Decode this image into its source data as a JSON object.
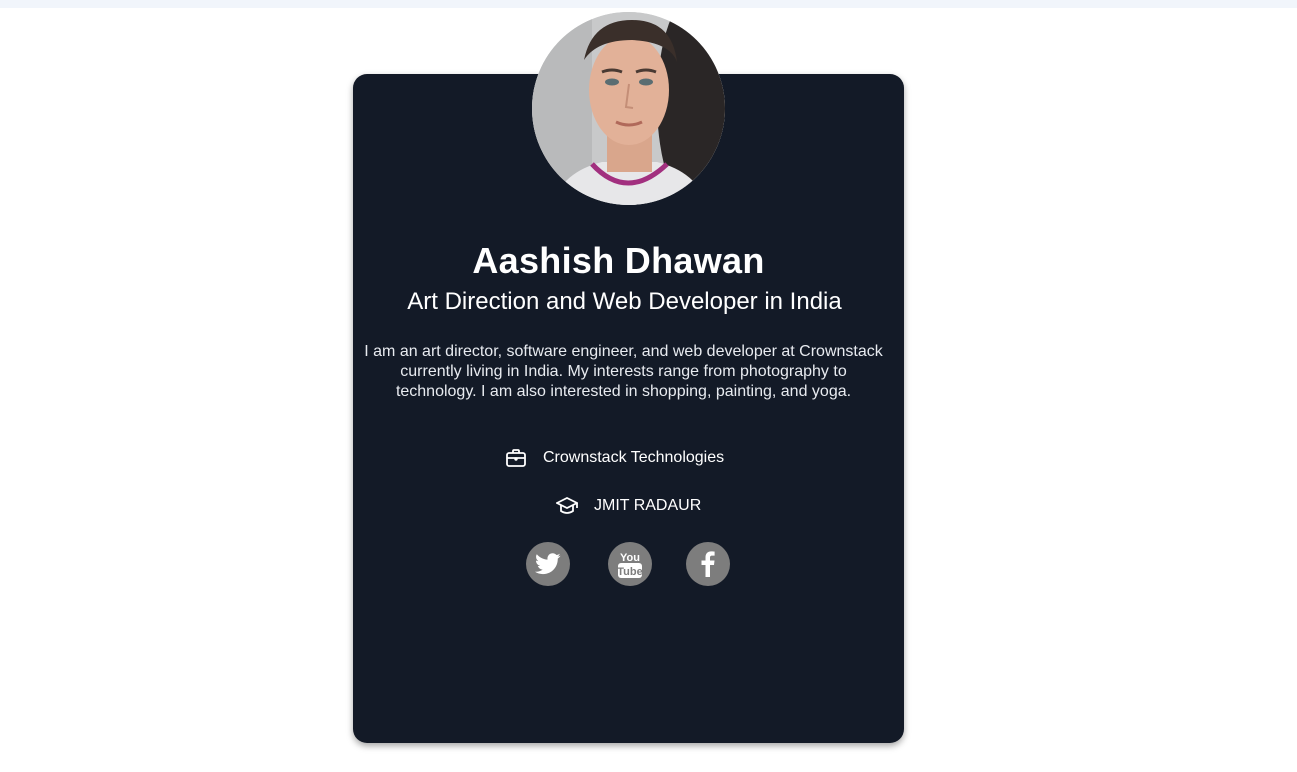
{
  "profile": {
    "name": "Aashish Dhawan",
    "title": "Art Direction and Web Developer in India",
    "bio": "I am an art director, software engineer, and web developer at Crownstack currently living in India. My interests range from photography to technology. I am also interested in shopping, painting, and yoga.",
    "company": "Crownstack Technologies",
    "school": "JMIT RADAUR"
  },
  "icons": {
    "company": "briefcase-icon",
    "school": "graduation-cap-icon",
    "social": [
      "twitter-icon",
      "youtube-icon",
      "facebook-icon"
    ]
  },
  "colors": {
    "card_background": "#131a27",
    "social_button": "#7d7d7d",
    "text": "#ffffff"
  }
}
